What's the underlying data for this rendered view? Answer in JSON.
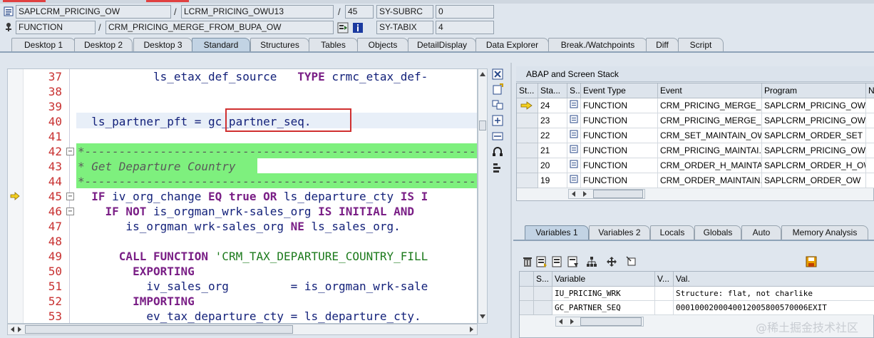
{
  "header": {
    "program": "SAPLCRM_PRICING_OW",
    "include": "LCRM_PRICING_OWU13",
    "line": "45",
    "subrc_label": "SY-SUBRC",
    "subrc_value": "0",
    "event_type": "FUNCTION",
    "event": "CRM_PRICING_MERGE_FROM_BUPA_OW",
    "tabix_label": "SY-TABIX",
    "tabix_value": "4",
    "slash": "/"
  },
  "tabs": [
    "Desktop 1",
    "Desktop 2",
    "Desktop 3",
    "Standard",
    "Structures",
    "Tables",
    "Objects",
    "DetailDisplay",
    "Data Explorer",
    "Break./Watchpoints",
    "Diff",
    "Script"
  ],
  "active_tab": "Standard",
  "code": {
    "line_numbers": [
      "37",
      "38",
      "39",
      "40",
      "41",
      "42",
      "43",
      "44",
      "45",
      "46",
      "47",
      "48",
      "49",
      "50",
      "51",
      "52",
      "53"
    ],
    "current_line": "45",
    "highlight_text": "gc_partner_seq."
  },
  "stack": {
    "title": "ABAP and Screen Stack",
    "columns": [
      "St...",
      "Sta...",
      "S...",
      "Event Type",
      "Event",
      "Program",
      "N"
    ],
    "rows": [
      {
        "level": "24",
        "type": "FUNCTION",
        "event": "CRM_PRICING_MERGE_F...",
        "program": "SAPLCRM_PRICING_OW",
        "current": true
      },
      {
        "level": "23",
        "type": "FUNCTION",
        "event": "CRM_PRICING_MERGE_M...",
        "program": "SAPLCRM_PRICING_OW",
        "current": false
      },
      {
        "level": "22",
        "type": "FUNCTION",
        "event": "CRM_SET_MAINTAIN_OW",
        "program": "SAPLCRM_ORDER_SET",
        "current": false
      },
      {
        "level": "21",
        "type": "FUNCTION",
        "event": "CRM_PRICING_MAINTAI...",
        "program": "SAPLCRM_PRICING_OW",
        "current": false
      },
      {
        "level": "20",
        "type": "FUNCTION",
        "event": "CRM_ORDER_H_MAINTA...",
        "program": "SAPLCRM_ORDER_H_OW",
        "current": false
      },
      {
        "level": "19",
        "type": "FUNCTION",
        "event": "CRM_ORDER_MAINTAIN...",
        "program": "SAPLCRM_ORDER_OW",
        "current": false
      }
    ]
  },
  "var_tabs": [
    "Variables 1",
    "Variables 2",
    "Locals",
    "Globals",
    "Auto",
    "Memory Analysis"
  ],
  "active_var_tab": "Variables 1",
  "variables": {
    "columns": [
      "S...",
      "Variable",
      "V...",
      "Val."
    ],
    "rows": [
      {
        "name": "IU_PRICING_WRK",
        "value": "Structure: flat, not charlike"
      },
      {
        "name": "GC_PARTNER_SEQ",
        "value": "0001000200040012005800570006EXIT"
      }
    ]
  },
  "watermark": "@稀土掘金技术社区",
  "colors": {
    "accent": "#c2d3e4",
    "highlight_box": "#d03030",
    "comment_bg": "#7ef07e",
    "current_line_bg": "#e8eff8"
  }
}
